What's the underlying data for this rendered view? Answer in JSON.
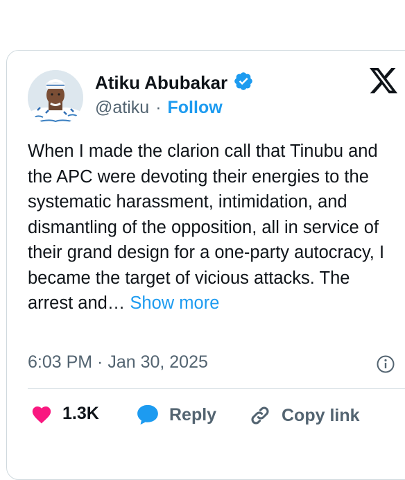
{
  "author": {
    "name": "Atiku Abubakar",
    "handle": "@atiku",
    "separator": "·",
    "follow_label": "Follow",
    "verified": true
  },
  "tweet": {
    "text": "When I made the clarion call that Tinubu and the APC were devoting their energies to the systematic harassment, intimidation, and dismantling of the opposition, all in service of their grand design for a one-party autocracy, I became the target of vicious attacks. The arrest and…",
    "show_more_label": "Show more",
    "timestamp": "6:03 PM · Jan 30, 2025"
  },
  "actions": {
    "like_count": "1.3K",
    "reply_label": "Reply",
    "copy_link_label": "Copy link"
  },
  "colors": {
    "accent": "#1d9bf0",
    "like": "#f91880",
    "text": "#0f1419",
    "secondary": "#536471"
  },
  "icons": [
    "verified-badge-icon",
    "x-logo-icon",
    "info-icon",
    "heart-icon",
    "reply-bubble-icon",
    "link-icon"
  ]
}
